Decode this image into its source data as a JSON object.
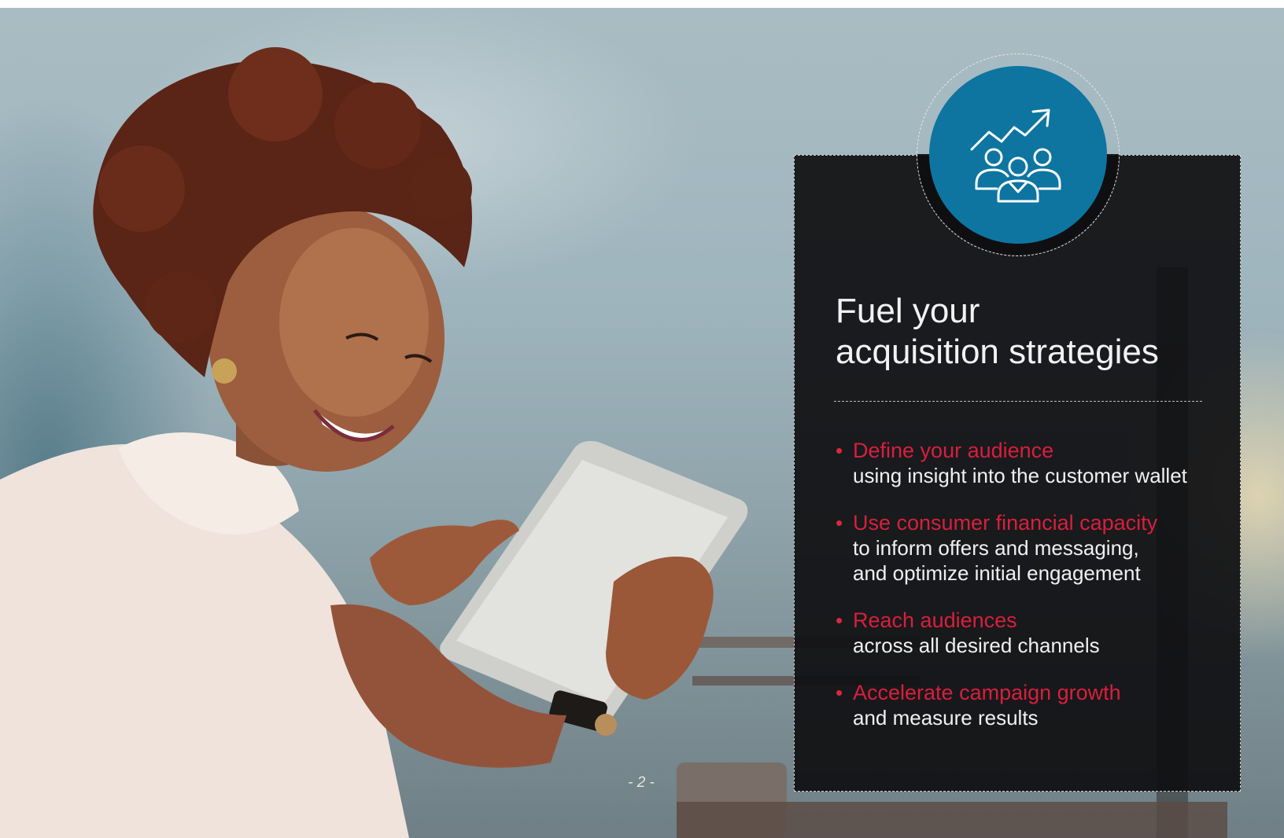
{
  "heading": {
    "line1": "Fuel your",
    "line2": "acquisition strategies"
  },
  "bullets": [
    {
      "headline": "Define your audience",
      "lines": [
        "using insight into the customer wallet"
      ]
    },
    {
      "headline": "Use consumer financial capacity",
      "lines": [
        "to inform offers and messaging,",
        "and optimize initial engagement"
      ]
    },
    {
      "headline": "Reach audiences",
      "lines": [
        "across all desired channels"
      ]
    },
    {
      "headline": "Accelerate campaign growth",
      "lines": [
        "and measure results"
      ]
    }
  ],
  "page_number": "- 2 -",
  "badge_icon": "growth-audience-icon",
  "colors": {
    "accent_red": "#d81f3d",
    "badge_blue": "#0d75a0",
    "panel": "#0e0e10"
  }
}
